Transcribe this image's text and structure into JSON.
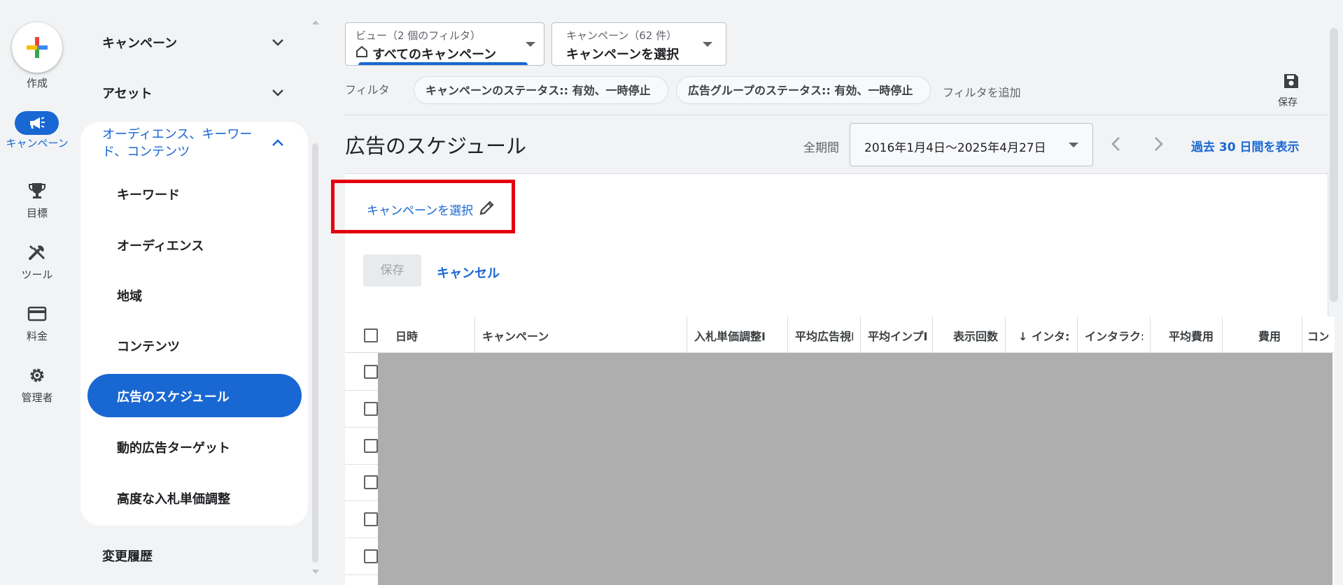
{
  "rail": {
    "create_label": "作成",
    "campaign_label": "キャンペーン",
    "goals_label": "目標",
    "tools_label": "ツール",
    "billing_label": "料金",
    "admin_label": "管理者"
  },
  "nav": {
    "campaigns": "キャンペーン",
    "assets": "アセット",
    "section_title": "オーディエンス、キーワード、コンテンツ",
    "items": [
      "キーワード",
      "オーディエンス",
      "地域",
      "コンテンツ",
      "広告のスケジュール",
      "動的広告ターゲット",
      "高度な入札単価調整"
    ],
    "change_history": "変更履歴"
  },
  "view_dropdown": {
    "small": "ビュー（2 個のフィルタ）",
    "main": "すべてのキャンペーン"
  },
  "campaign_dropdown": {
    "small": "キャンペーン（62 件）",
    "main": "キャンペーンを選択"
  },
  "filters": {
    "label": "フィルタ",
    "chips": [
      "キャンペーンのステータス:: 有効、一時停止",
      "広告グループのステータス:: 有効、一時停止"
    ],
    "add": "フィルタを追加"
  },
  "save_top_label": "保存",
  "page_title": "広告のスケジュール",
  "date": {
    "period_label": "全期間",
    "range": "2016年1月4日～2025年4月27日",
    "last30": "過去 30 日間を表示"
  },
  "editor": {
    "select_campaign": "キャンペーンを選択",
    "save": "保存",
    "cancel": "キャンセル"
  },
  "table": {
    "headers": [
      "日時",
      "キャンペーン",
      "入札単価調整Ⅰ",
      "平均広告視Ⅰ",
      "平均インプⅠ",
      "表示回数",
      "↓ インタ:",
      "インタラク:",
      "平均費用",
      "費用",
      "コン"
    ]
  },
  "colors": {
    "accent": "#1967d2",
    "highlight": "#e3000f"
  }
}
